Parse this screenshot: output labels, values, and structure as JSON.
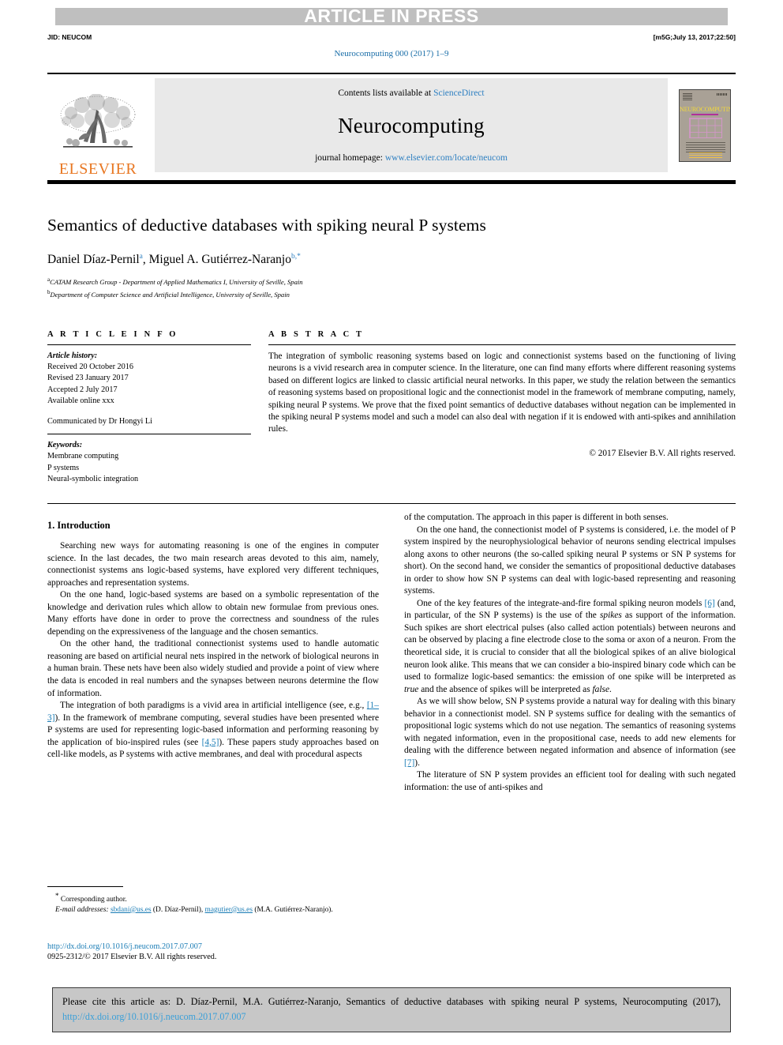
{
  "banner": {
    "text": "ARTICLE IN PRESS",
    "background_color": "#bfbfbf"
  },
  "header": {
    "jid": "JID: NEUCOM",
    "build_stamp": "[m5G;July 13, 2017;22:50]",
    "journal_reference": "Neurocomputing 000 (2017) 1–9"
  },
  "masthead": {
    "publisher_name": "ELSEVIER",
    "contents_prefix": "Contents lists available at ",
    "contents_link": "ScienceDirect",
    "journal_name": "Neurocomputing",
    "homepage_prefix": "journal homepage: ",
    "homepage_link": "www.elsevier.com/locate/neucom",
    "cover_title": "NEUROCOMPUTING"
  },
  "article": {
    "title": "Semantics of deductive databases with spiking neural P systems",
    "authors": [
      {
        "name": "Daniel Díaz-Pernil",
        "marks": "a"
      },
      {
        "name": "Miguel A. Gutiérrez-Naranjo",
        "marks": "b"
      }
    ],
    "authors_line_1": "Daniel Díaz-Pernil",
    "authors_sep": ", ",
    "authors_line_2": "Miguel A. Gutiérrez-Naranjo",
    "mark_a": "a",
    "mark_b": "b",
    "mark_star": ",*",
    "affiliations": [
      {
        "mark": "a",
        "text": "CATAM Research Group - Department of Applied Mathematics I, University of Seville, Spain"
      },
      {
        "mark": "b",
        "text": "Department of Computer Science and Artificial Intelligence, University of Seville, Spain"
      }
    ]
  },
  "article_info": {
    "heading": "A R T I C L E    I N F O",
    "history_label": "Article history:",
    "received": "Received 20 October 2016",
    "revised": "Revised 23 January 2017",
    "accepted": "Accepted 2 July 2017",
    "available": "Available online xxx",
    "communicated": "Communicated by Dr Hongyi Li",
    "keywords_label": "Keywords:",
    "keywords": [
      "Membrane computing",
      "P systems",
      "Neural-symbolic integration"
    ]
  },
  "abstract": {
    "heading": "A B S T R A C T",
    "text": "The integration of symbolic reasoning systems based on logic and connectionist systems based on the functioning of living neurons is a vivid research area in computer science. In the literature, one can find many efforts where different reasoning systems based on different logics are linked to classic artificial neural networks. In this paper, we study the relation between the semantics of reasoning systems based on propositional logic and the connectionist model in the framework of membrane computing, namely, spiking neural P systems. We prove that the fixed point semantics of deductive databases without negation can be implemented in the spiking neural P systems model and such a model can also deal with negation if it is endowed with anti-spikes and annihilation rules.",
    "copyright": "© 2017 Elsevier B.V. All rights reserved."
  },
  "body": {
    "section_title": "1. Introduction",
    "left_paragraphs": [
      "Searching new ways for automating reasoning is one of the engines in computer science. In the last decades, the two main research areas devoted to this aim, namely, connectionist systems ans logic-based systems, have explored very different techniques, approaches and representation systems.",
      "On the one hand, logic-based systems are based on a symbolic representation of the knowledge and derivation rules which allow to obtain new formulae from previous ones. Many efforts have done in order to prove the correctness and soundness of the rules depending on the expressiveness of the language and the chosen semantics.",
      "On the other hand, the traditional connectionist systems used to handle automatic reasoning are based on artificial neural nets inspired in the network of biological neurons in a human brain. These nets have been also widely studied and provide a point of view where the data is encoded in real numbers and the synapses between neurons determine the flow of information."
    ],
    "left_paragraph_4_part1": "The integration of both paradigms is a vivid area in artificial intelligence (see, e.g., ",
    "left_ref_1": "[1–3]",
    "left_paragraph_4_part2": "). In the framework of membrane computing, several studies have been presented where P systems are used for representing logic-based information and performing reasoning by the application of bio-inspired rules (see ",
    "left_ref_2": "[4,5]",
    "left_paragraph_4_part3": "). These papers study approaches based on cell-like models, as P systems with active membranes, and deal with procedural aspects",
    "right_paragraphs": [
      "of the computation. The approach in this paper is different in both senses.",
      "On the one hand, the connectionist model of P systems is considered, i.e. the model of P system inspired by the neurophysiological behavior of neurons sending electrical impulses along axons to other neurons (the so-called spiking neural P systems or SN P systems for short). On the second hand, we consider the semantics of propositional deductive databases in order to show how SN P systems can deal with logic-based representing and reasoning systems."
    ],
    "right_p3_part1": "One of the key features of the integrate-and-fire formal spiking neuron models ",
    "right_ref_6": "[6]",
    "right_p3_part2": " (and, in particular, of the SN P systems) is the use of the ",
    "right_p3_em1": "spikes",
    "right_p3_part3": " as support of the information. Such spikes are short electrical pulses (also called action potentials) between neurons and can be observed by placing a fine electrode close to the soma or axon of a neuron. From the theoretical side, it is crucial to consider that all the biological spikes of an alive biological neuron look alike. This means that we can consider a bio-inspired binary code which can be used to formalize logic-based semantics: the emission of one spike will be interpreted as ",
    "right_p3_em2": "true",
    "right_p3_part4": " and the absence of spikes will be interpreted as ",
    "right_p3_em3": "false",
    "right_p3_part5": ".",
    "right_p4_part1": "As we will show below, SN P systems provide a natural way for dealing with this binary behavior in a connectionist model. SN P systems suffice for dealing with the semantics of propositional logic systems which do not use negation. The semantics of reasoning systems with negated information, even in the propositional case, needs to add new elements for dealing with the difference between negated information and absence of information (see ",
    "right_ref_7": "[7]",
    "right_p4_part2": ").",
    "right_p5": "The literature of SN P system provides an efficient tool for dealing with such negated information: the use of anti-spikes and"
  },
  "footnote": {
    "star": "*",
    "corresponding": "Corresponding author.",
    "email_label": "E-mail addresses:",
    "email_1": "sbdani@us.es",
    "email_1_owner": "(D. Díaz-Pernil),",
    "email_2": "magutier@us.es",
    "email_2_owner": "(M.A. Gutiérrez-Naranjo).",
    "doi": "http://dx.doi.org/10.1016/j.neucom.2017.07.007",
    "issn": "0925-2312/© 2017 Elsevier B.V. All rights reserved."
  },
  "cite_box": {
    "prefix": "Please cite this article as: D. Díaz-Pernil, M.A. Gutiérrez-Naranjo, Semantics of deductive databases with spiking neural P systems, Neurocomputing (2017), ",
    "link": "http://dx.doi.org/10.1016/j.neucom.2017.07.007"
  },
  "colors": {
    "link_blue": "#2d7fc1",
    "ref_blue": "#1a7cb5",
    "elsevier_orange": "#e87722",
    "banner_gray": "#bfbfbf",
    "cite_box_gray": "#c7c7c7"
  }
}
